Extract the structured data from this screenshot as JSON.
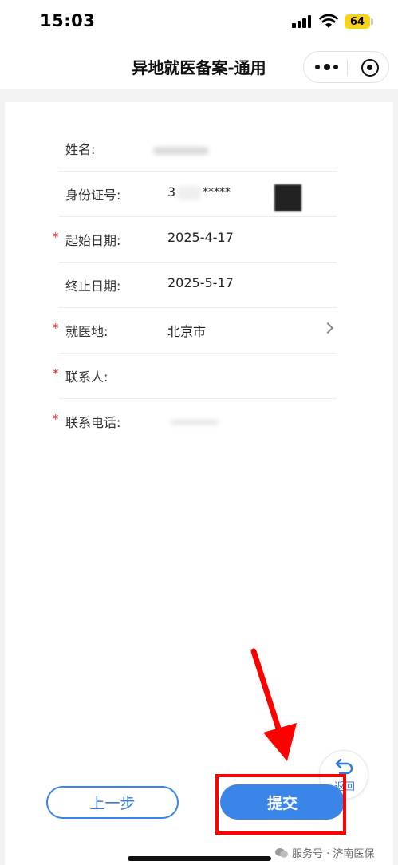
{
  "status_bar": {
    "time": "15:03",
    "battery": "64"
  },
  "nav": {
    "title": "异地就医备案-通用"
  },
  "form": {
    "rows": [
      {
        "label": "姓名:",
        "value": "",
        "required": false
      },
      {
        "label": "身份证号:",
        "value": "3",
        "value_suffix": "*****",
        "required": false
      },
      {
        "label": "起始日期:",
        "value": "2025-4-17",
        "required": true
      },
      {
        "label": "终止日期:",
        "value": "2025-5-17",
        "required": false
      },
      {
        "label": "就医地:",
        "value": "北京市",
        "required": true
      },
      {
        "label": "联系人:",
        "value": "",
        "required": true
      },
      {
        "label": "联系电话:",
        "value": "",
        "required": true
      }
    ],
    "required_mark": "*"
  },
  "buttons": {
    "prev_label": "上一步",
    "submit_label": "提交"
  },
  "float_back": {
    "label": "返回"
  },
  "watermark": {
    "text": "服务号 · 济南医保"
  },
  "colors": {
    "accent": "#3a86e8",
    "required": "#e02020",
    "annotation": "#ff0000",
    "battery": "#f7d417"
  }
}
